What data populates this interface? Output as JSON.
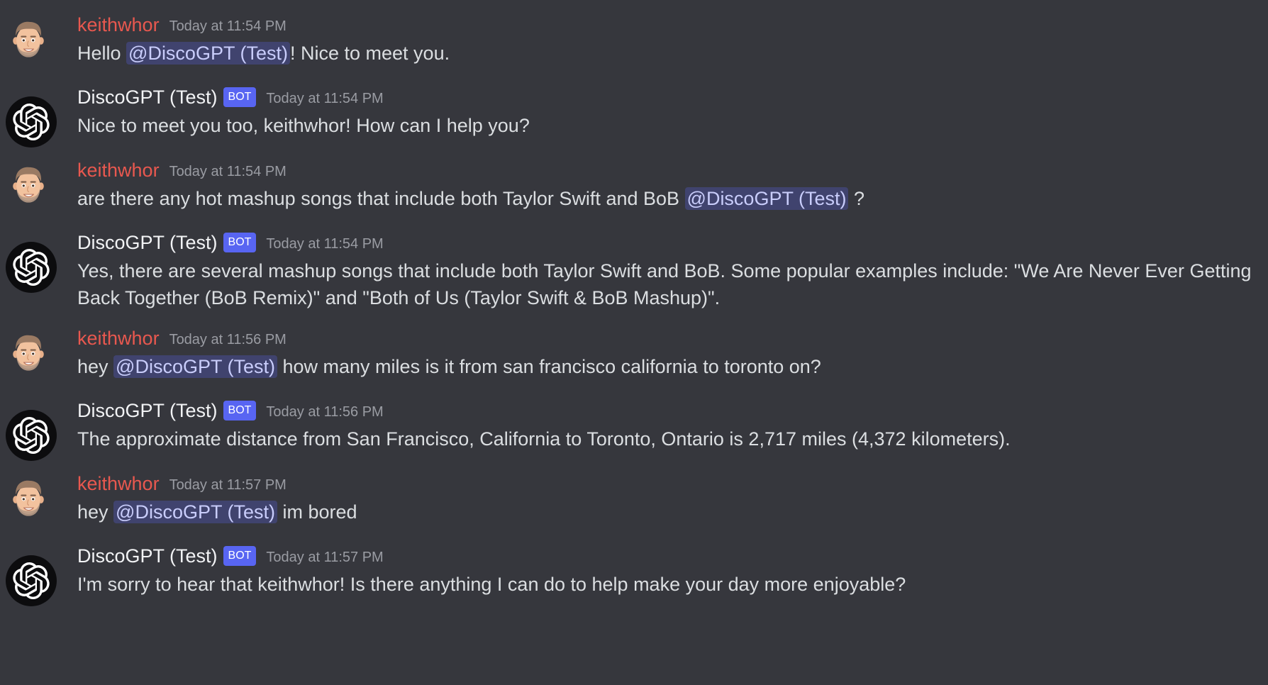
{
  "colors": {
    "background": "#36373d",
    "user_name": "#e8584f",
    "bot_name": "#f2f3f5",
    "bot_tag": "#5865f2",
    "mention_bg": "#40436e",
    "mention_text": "#c9cdfb",
    "timestamp": "#9a9ca3"
  },
  "messages": [
    {
      "author": "keithwhor",
      "timestamp": "Today at 11:54 PM",
      "avatar_icon": "memoji-avatar-icon",
      "parts": [
        "Hello ",
        "@DiscoGPT (Test)",
        "! Nice to meet you."
      ]
    },
    {
      "author": "DiscoGPT (Test)",
      "tag": "BOT",
      "timestamp": "Today at 11:54 PM",
      "avatar_icon": "openai-logo-icon",
      "text": "Nice to meet you too, keithwhor! How can I help you?"
    },
    {
      "author": "keithwhor",
      "timestamp": "Today at 11:54 PM",
      "avatar_icon": "memoji-avatar-icon",
      "parts": [
        "are there any hot mashup songs that include both Taylor Swift and BoB ",
        "@DiscoGPT (Test)",
        " ?"
      ]
    },
    {
      "author": "DiscoGPT (Test)",
      "tag": "BOT",
      "timestamp": "Today at 11:54 PM",
      "avatar_icon": "openai-logo-icon",
      "text": "Yes, there are several mashup songs that include both Taylor Swift and BoB. Some popular examples include: \"We Are Never Ever Getting Back Together (BoB Remix)\" and \"Both of Us (Taylor Swift & BoB Mashup)\"."
    },
    {
      "author": "keithwhor",
      "timestamp": "Today at 11:56 PM",
      "avatar_icon": "memoji-avatar-icon",
      "parts": [
        "hey ",
        "@DiscoGPT (Test)",
        " how many miles is it from san francisco california to toronto on?"
      ]
    },
    {
      "author": "DiscoGPT (Test)",
      "tag": "BOT",
      "timestamp": "Today at 11:56 PM",
      "avatar_icon": "openai-logo-icon",
      "text": "The approximate distance from San Francisco, California to Toronto, Ontario is 2,717 miles (4,372 kilometers)."
    },
    {
      "author": "keithwhor",
      "timestamp": "Today at 11:57 PM",
      "avatar_icon": "memoji-avatar-icon",
      "parts": [
        "hey ",
        "@DiscoGPT (Test)",
        " im bored"
      ]
    },
    {
      "author": "DiscoGPT (Test)",
      "tag": "BOT",
      "timestamp": "Today at 11:57 PM",
      "avatar_icon": "openai-logo-icon",
      "text": "I'm sorry to hear that keithwhor! Is there anything I can do to help make your day more enjoyable?"
    }
  ]
}
